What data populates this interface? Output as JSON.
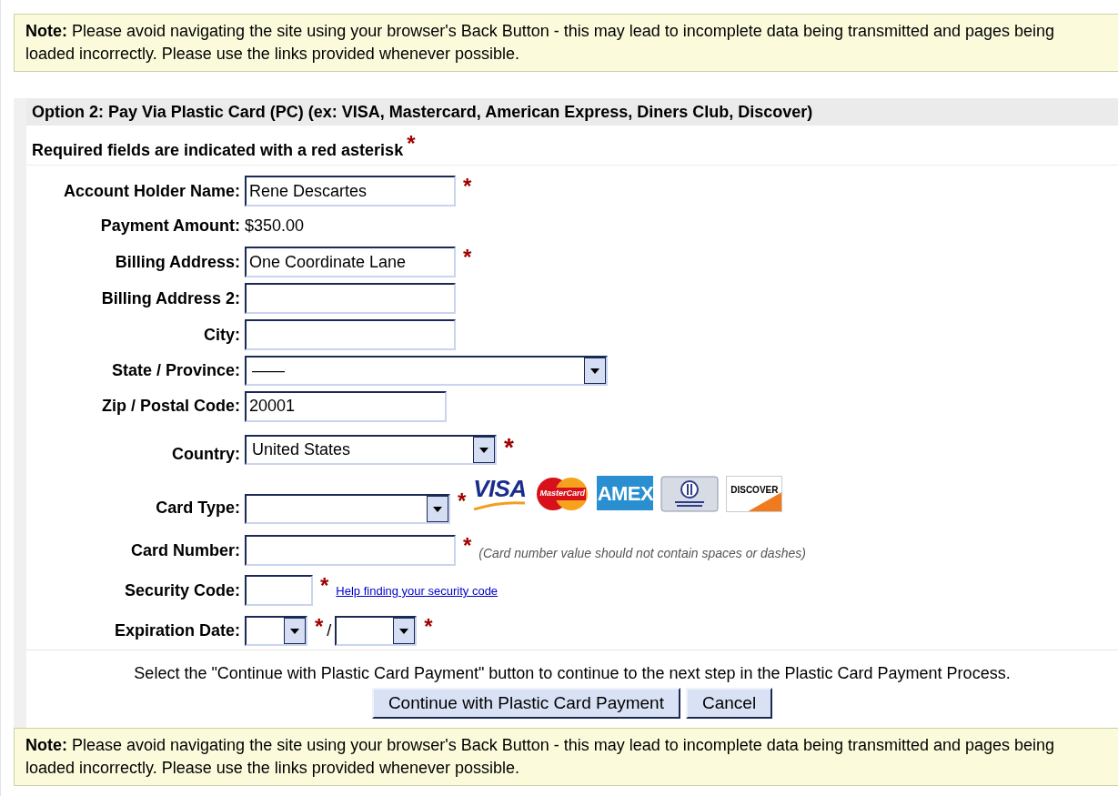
{
  "notes": [
    {
      "text": "**Note:** Please avoid navigating the site using your browser's Back Button - this may lead to incomplete data being transmitted and pages being loaded incorrectly. Please use the links provided whenever possible."
    },
    {
      "text": "**Note:** Please avoid navigating the site using your browser's Back Button - this may lead to incomplete data being transmitted and pages being loaded incorrectly. Please use the links provided whenever possible."
    }
  ],
  "section": {
    "title": "Option 2: Pay Via Plastic Card (PC) (ex: VISA, Mastercard, American Express, Diners Club, Discover)",
    "required_note": "Required fields are indicated with a red asterisk",
    "required_mark": "*"
  },
  "fields": [
    {
      "kind": "text",
      "label": "Account Holder Name:",
      "value": "Rene Descartes",
      "required_mark": "*"
    },
    {
      "kind": "static",
      "label": "Payment Amount:",
      "value": "$350.00"
    },
    {
      "kind": "text",
      "label": "Billing Address:",
      "value": "One Coordinate Lane",
      "required_mark": "*"
    },
    {
      "kind": "text",
      "label": "Billing Address 2:"
    },
    {
      "kind": "text",
      "label": "City:"
    },
    {
      "kind": "wide-select",
      "label": "State / Province:",
      "value": "——"
    },
    {
      "kind": "short-text",
      "label": "Zip / Postal Code:",
      "value": "20001"
    },
    {
      "kind": "select",
      "label": "Country:",
      "value": "United States",
      "required_mark": "*"
    },
    {
      "kind": "card-select",
      "label": "Card Type:",
      "required_mark": "*",
      "card_logos": [
        {
          "kind": "visa",
          "label": "VISA"
        },
        {
          "kind": "mastercard",
          "label": "MasterCard"
        },
        {
          "kind": "amex",
          "label": "AMEX"
        },
        {
          "kind": "diners"
        },
        {
          "kind": "discover",
          "label": "DISCOVER"
        }
      ]
    },
    {
      "kind": "text",
      "label": "Card Number:",
      "required_mark": "*",
      "hint": "(Card number value should not contain spaces or dashes)"
    },
    {
      "kind": "code",
      "label": "Security Code:",
      "required_mark": "*",
      "link": "Help finding your security code"
    },
    {
      "kind": "expiry",
      "label": "Expiration Date:",
      "month_mark": "*",
      "separator": "/",
      "year_mark": "*"
    }
  ],
  "instruction": "Select the \"Continue with Plastic Card Payment\" button to continue to the next step in the Plastic Card Payment Process.",
  "buttons": [
    "Continue with Plastic Card Payment",
    "Cancel"
  ]
}
